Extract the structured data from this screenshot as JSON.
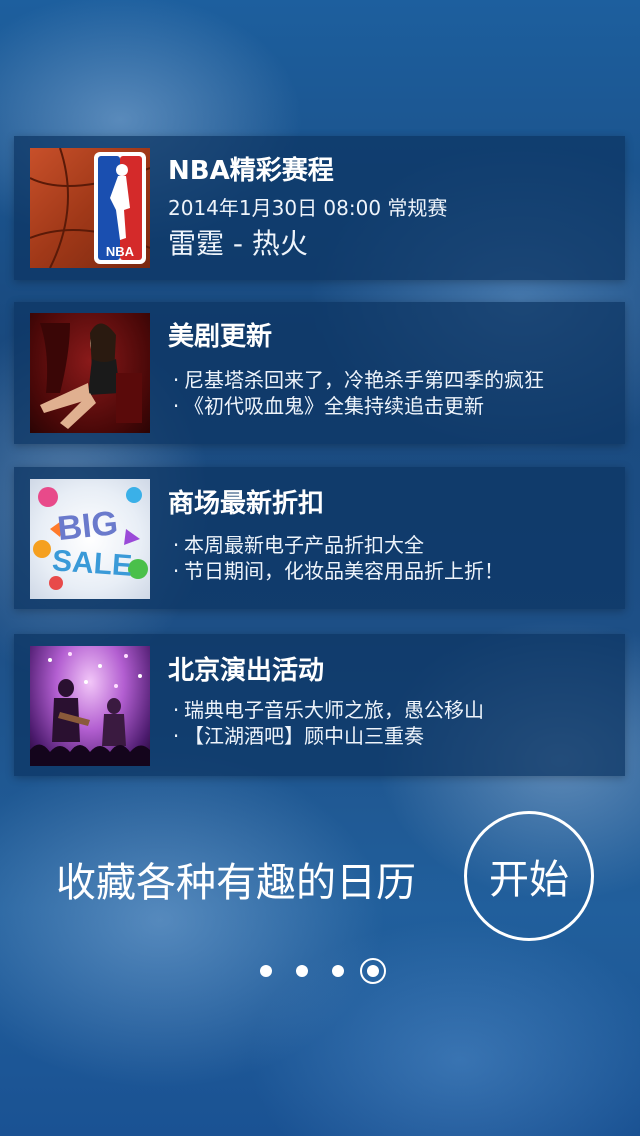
{
  "cards": [
    {
      "title": "NBA精彩赛程",
      "line1": "2014年1月30日  08:00 常规赛",
      "line2": "雷霆  -  热火",
      "logo_text": "NBA"
    },
    {
      "title": "美剧更新",
      "bullet": "·",
      "items": [
        "尼基塔杀回来了，冷艳杀手第四季的疯狂",
        "《初代吸血鬼》全集持续追击更新"
      ]
    },
    {
      "title": "商场最新折扣",
      "bullet": "·",
      "items": [
        "本周最新电子产品折扣大全",
        "节日期间，化妆品美容用品折上折！"
      ],
      "sale_art": {
        "big": "BIG",
        "sale": "SALE"
      }
    },
    {
      "title": "北京演出活动",
      "bullet": "·",
      "items": [
        "瑞典电子音乐大师之旅，愚公移山",
        "【江湖酒吧】顾中山三重奏"
      ]
    }
  ],
  "tagline": "收藏各种有趣的日历",
  "start_button": "开始",
  "pagination": {
    "count": 4,
    "active": 4
  },
  "colors": {
    "card_bg": "#0c3462",
    "background": "#1d4f86",
    "text": "#ffffff"
  }
}
